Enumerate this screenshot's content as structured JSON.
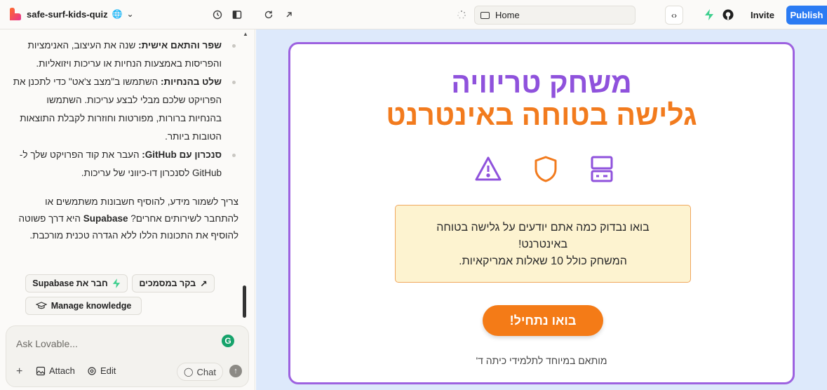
{
  "topbar": {
    "project_name": "safe-surf-kids-quiz",
    "address": "Home",
    "invite_label": "Invite",
    "publish_label": "Publish"
  },
  "chat": {
    "bullets": [
      {
        "strong": "שפר והתאם אישית:",
        "text": " שנה את העיצוב, האנימציות והפריסות באמצעות הנחיות או עריכות ויזואליות."
      },
      {
        "strong": "שלט בהנחיות:",
        "text": " השתמשו ב\"מצב צ'אט\" כדי לתכנן את הפרויקט שלכם מבלי לבצע עריכות. השתמשו בהנחיות ברורות, מפורטות וחוזרות לקבלת התוצאות הטובות ביותר."
      },
      {
        "strong": "סנכרון עם GitHub:",
        "text": " העבר את קוד הפרויקט שלך ל-GitHub לסנכרון דו-כיווני של עריכות."
      }
    ],
    "para_before": "צריך לשמור מידע, להוסיף חשבונות משתמשים או להתחבר לשירותים אחרים? ",
    "para_strong": "Supabase",
    "para_after": " היא דרך פשוטה להוסיף את התכונות הללו ללא הגדרה טכנית מורכבת."
  },
  "actions": {
    "visit_docs": "בקר במסמכים",
    "connect_supabase": "חבר את Supabase",
    "manage_knowledge": "Manage knowledge"
  },
  "input": {
    "placeholder": "Ask Lovable...",
    "attach_label": "Attach",
    "edit_label": "Edit",
    "chat_label": "Chat"
  },
  "preview": {
    "title_line1": "משחק טריוויה",
    "title_line2": "גלישה בטוחה באינטרנט",
    "info_line1": "בואו נבדוק כמה אתם יודעים על גלישה בטוחה",
    "info_line2": "באינטרנט!",
    "info_line3": "המשחק כולל 10 שאלות אמריקאיות.",
    "start_button": "בואו נתחיל!",
    "footer": "מותאם במיוחד לתלמידי כיתה ד'"
  },
  "colors": {
    "purple": "#8f52dc",
    "orange": "#f27b1e",
    "publish_blue": "#2b7bf3",
    "preview_bg": "#dde9fb"
  }
}
